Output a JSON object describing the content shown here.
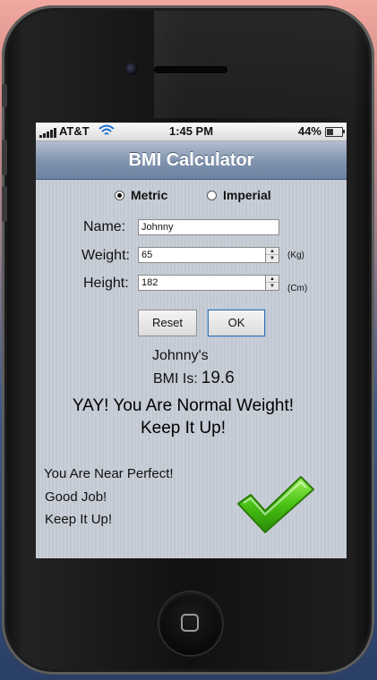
{
  "status_bar": {
    "carrier": "AT&T",
    "time": "1:45 PM",
    "battery_percent": "44%",
    "battery_level": 0.44,
    "signal_icon": "signal-bars-icon",
    "wifi_icon": "wifi-icon"
  },
  "nav": {
    "title": "BMI Calculator"
  },
  "units": {
    "metric_label": "Metric",
    "imperial_label": "Imperial",
    "selected": "Metric"
  },
  "form": {
    "name_label": "Name:",
    "name_value": "Johnny",
    "weight_label": "Weight:",
    "weight_value": "65",
    "weight_unit": "(Kg)",
    "height_label": "Height:",
    "height_value": "182",
    "height_unit": "(Cm)"
  },
  "buttons": {
    "reset_label": "Reset",
    "ok_label": "OK"
  },
  "result": {
    "name_line": "Johnny's",
    "bmi_label": "BMI Is:",
    "bmi_value": "19.6",
    "message_line1": "YAY! You Are Normal Weight!",
    "message_line2": "Keep It Up!"
  },
  "encouragement": {
    "line1": "You Are Near Perfect!",
    "line2": "Good Job!",
    "line3": "Keep It Up!"
  },
  "colors": {
    "nav_bar": "#7f92ad",
    "checkmark_green": "#48c214",
    "screen_background": "#c6ccd6"
  }
}
